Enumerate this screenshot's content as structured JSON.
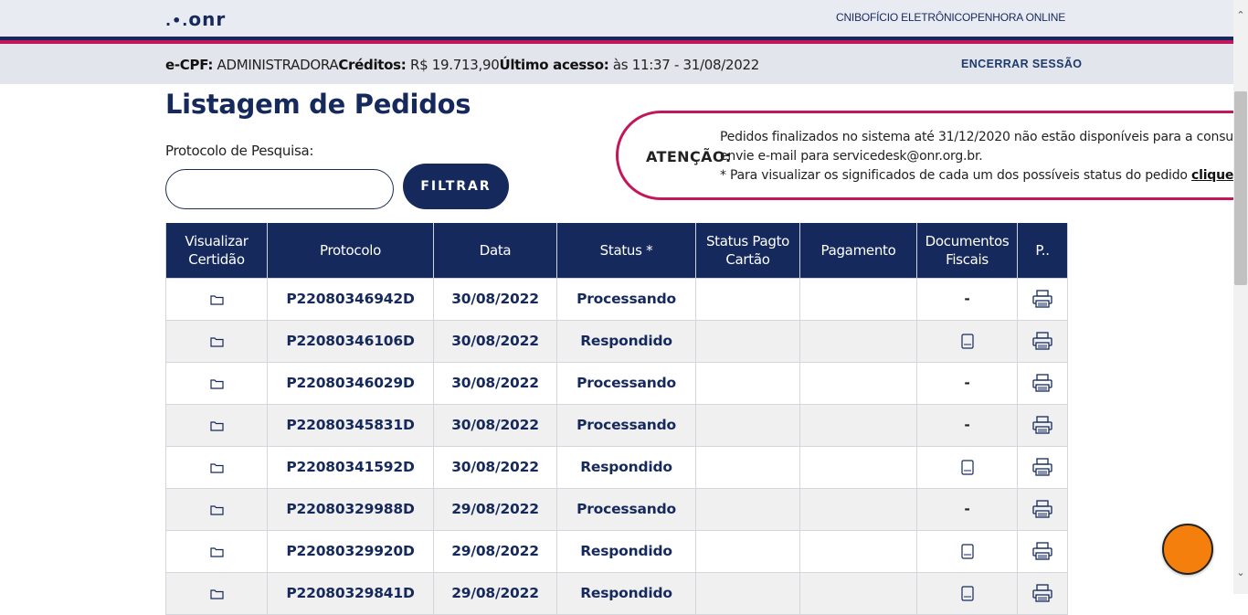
{
  "header": {
    "logo_text": "onr",
    "nav": [
      "CNIB",
      "OFÍCIO ELETRÔNICO",
      "PENHORA ONLINE"
    ]
  },
  "infobar": {
    "ecpf_label": "e-CPF:",
    "ecpf_value": "ADMINISTRADORA",
    "credits_label": "Créditos:",
    "credits_value": "R$ 19.713,90",
    "last_access_label": "Último acesso:",
    "last_access_value": "às 11:37 - 31/08/2022",
    "logout_label": "ENCERRAR SESSÃO"
  },
  "page": {
    "title": "Listagem de Pedidos",
    "search_label": "Protocolo de Pesquisa:",
    "search_value": "",
    "filter_label": "FILTRAR"
  },
  "attention": {
    "label": "ATENÇÃO:",
    "line1": "Pedidos finalizados no sistema até 31/12/2020 não estão disponíveis para a consulta. C",
    "line2": "envie e-mail para servicedesk@onr.org.br.",
    "line3_prefix": "* Para visualizar os significados de cada um dos possíveis status do pedido ",
    "line3_link": "clique aqu"
  },
  "table": {
    "headers": [
      "Visualizar Certidão",
      "Protocolo",
      "Data",
      "Status *",
      "Status Pagto Cartão",
      "Pagamento",
      "Documentos Fiscais",
      "P.."
    ],
    "rows": [
      {
        "protocolo": "P22080346942D",
        "data": "30/08/2022",
        "status": "Processando",
        "doc": "-"
      },
      {
        "protocolo": "P22080346106D",
        "data": "30/08/2022",
        "status": "Respondido",
        "doc": "doc-icon"
      },
      {
        "protocolo": "P22080346029D",
        "data": "30/08/2022",
        "status": "Processando",
        "doc": "-"
      },
      {
        "protocolo": "P22080345831D",
        "data": "30/08/2022",
        "status": "Processando",
        "doc": "-"
      },
      {
        "protocolo": "P22080341592D",
        "data": "30/08/2022",
        "status": "Respondido",
        "doc": "doc-icon"
      },
      {
        "protocolo": "P22080329988D",
        "data": "29/08/2022",
        "status": "Processando",
        "doc": "-"
      },
      {
        "protocolo": "P22080329920D",
        "data": "29/08/2022",
        "status": "Respondido",
        "doc": "doc-icon"
      },
      {
        "protocolo": "P22080329841D",
        "data": "29/08/2022",
        "status": "Respondido",
        "doc": "doc-icon"
      }
    ]
  },
  "colors": {
    "navy": "#16295c",
    "pink": "#c2185b",
    "orange": "#f57f0c"
  }
}
